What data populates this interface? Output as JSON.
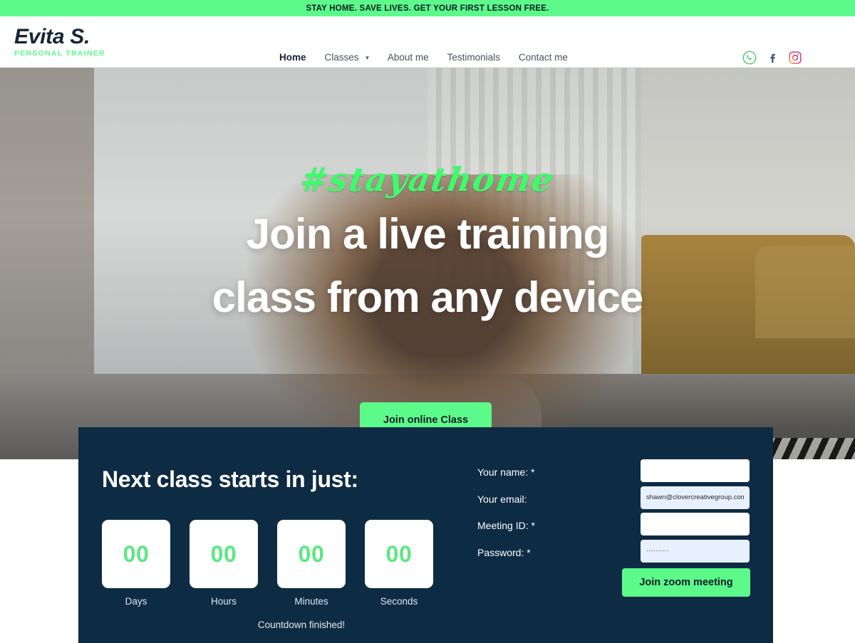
{
  "announcement": {
    "text": "STAY HOME. SAVE LIVES. GET YOUR FIRST LESSON FREE.",
    "background": "#5cfa8a"
  },
  "header": {
    "logo": {
      "name": "Evita S.",
      "tagline": "PERSONAL TRAINER",
      "tagline_color": "#5cfa8a"
    },
    "nav": [
      {
        "label": "Home",
        "active": true,
        "has_dropdown": false
      },
      {
        "label": "Classes",
        "active": false,
        "has_dropdown": true
      },
      {
        "label": "About me",
        "active": false,
        "has_dropdown": false
      },
      {
        "label": "Testimonials",
        "active": false,
        "has_dropdown": false
      },
      {
        "label": "Contact me",
        "active": false,
        "has_dropdown": false
      }
    ],
    "socials": [
      {
        "name": "whatsapp-icon",
        "color": "#3ec75a"
      },
      {
        "name": "facebook-icon",
        "color": "#3b5998"
      },
      {
        "name": "instagram-icon",
        "color": "#e1306c"
      }
    ]
  },
  "hero": {
    "script_text": "#stayathome",
    "script_color": "#3dfc6b",
    "title_line1": "Join a live training",
    "title_line2": "class from any device",
    "cta_label": "Join online Class",
    "cta_color": "#5cfa8a"
  },
  "panel": {
    "background": "#0e2b44",
    "title": "Next class starts in just:",
    "countdown": [
      {
        "value": "00",
        "label": "Days"
      },
      {
        "value": "00",
        "label": "Hours"
      },
      {
        "value": "00",
        "label": "Minutes"
      },
      {
        "value": "00",
        "label": "Seconds"
      }
    ],
    "countdown_value_color": "#5ce783",
    "countdown_status": "Countdown finished!",
    "form": {
      "fields": [
        {
          "label": "Your name: *",
          "value": "",
          "placeholder": "",
          "autofilled": false,
          "type": "text",
          "name": "name-field"
        },
        {
          "label": "Your email:",
          "value": "shawn@clovercreativegroup.com",
          "placeholder": "",
          "autofilled": true,
          "type": "text",
          "name": "email-field"
        },
        {
          "label": "Meeting ID: *",
          "value": "",
          "placeholder": "",
          "autofilled": false,
          "type": "text",
          "name": "meeting-id-field"
        },
        {
          "label": "Password: *",
          "value": "··········",
          "placeholder": "",
          "autofilled": true,
          "type": "password",
          "name": "password-field"
        }
      ],
      "submit_label": "Join zoom meeting",
      "submit_color": "#5cfa8a"
    }
  }
}
